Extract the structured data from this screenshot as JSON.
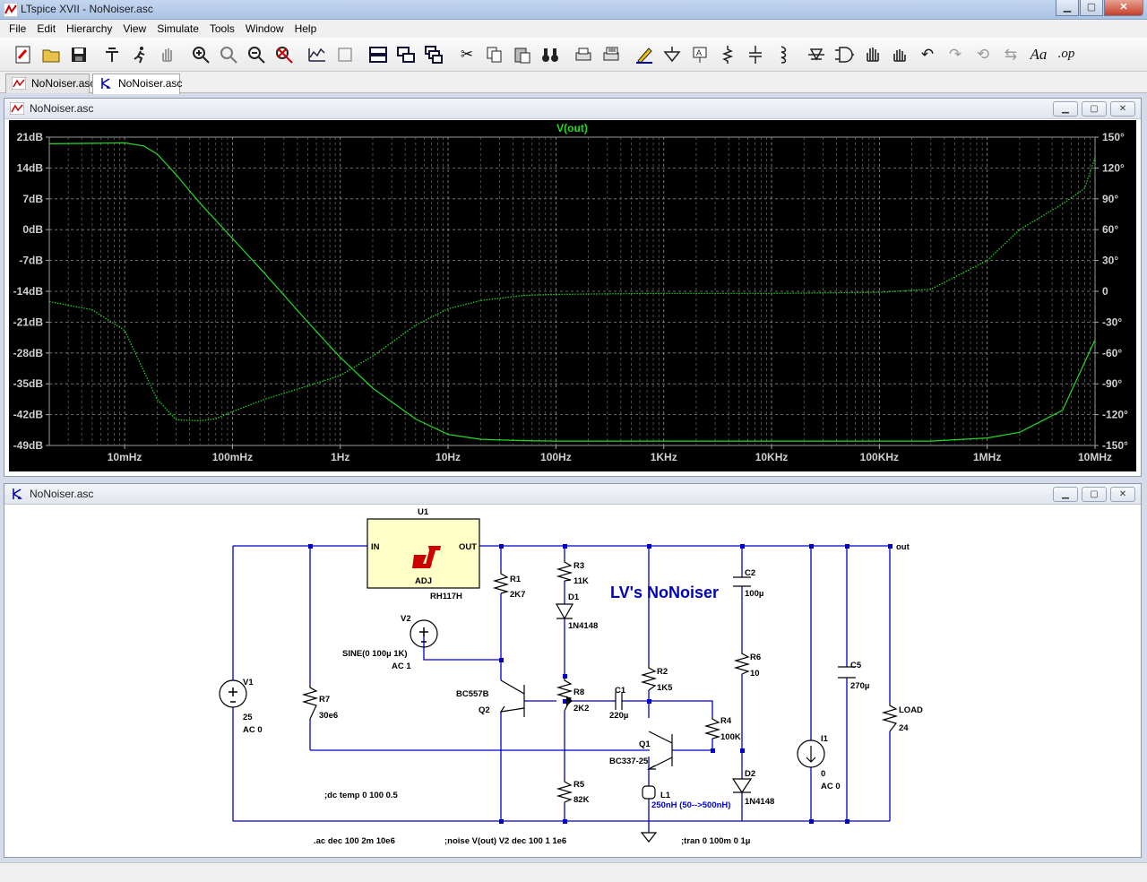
{
  "window": {
    "title": "LTspice XVII - NoNoiser.asc",
    "min_label": "▁",
    "max_label": "▢",
    "close_label": "✕"
  },
  "menu": [
    "File",
    "Edit",
    "Hierarchy",
    "View",
    "Simulate",
    "Tools",
    "Window",
    "Help"
  ],
  "toolbar_icons": [
    "new-schematic",
    "open",
    "save",
    "control-panel",
    "run",
    "halt",
    "zoom-in",
    "pan",
    "zoom-out",
    "zoom-fit",
    "autorange",
    "plot-settings",
    "tile-horizontal",
    "tile-vertical",
    "cascade",
    "cut",
    "copy",
    "paste",
    "find",
    "print",
    "print-setup",
    "wire",
    "ground",
    "label",
    "resistor",
    "capacitor",
    "inductor",
    "diode",
    "component",
    "move",
    "drag",
    "undo",
    "redo",
    "rotate",
    "mirror",
    "text",
    "spice-directive"
  ],
  "tabs": [
    {
      "label": "NoNoiser.asc",
      "kind": "waveform"
    },
    {
      "label": "NoNoiser.asc",
      "kind": "schematic"
    }
  ],
  "plot_window": {
    "title": "NoNoiser.asc",
    "trace_label": "V(out)",
    "trace_color": "#22dd22",
    "background": "#000000"
  },
  "schematic_window": {
    "title": "NoNoiser.asc",
    "heading": "LV's NoNoiser"
  },
  "chart_data": {
    "type": "line",
    "title": "V(out)",
    "x_scale": "log",
    "xlim": [
      0.002,
      10000000
    ],
    "x_ticks": [
      {
        "v": 0.01,
        "label": "10mHz"
      },
      {
        "v": 0.1,
        "label": "100mHz"
      },
      {
        "v": 1,
        "label": "1Hz"
      },
      {
        "v": 10,
        "label": "10Hz"
      },
      {
        "v": 100,
        "label": "100Hz"
      },
      {
        "v": 1000,
        "label": "1KHz"
      },
      {
        "v": 10000,
        "label": "10KHz"
      },
      {
        "v": 100000,
        "label": "100KHz"
      },
      {
        "v": 1000000,
        "label": "1MHz"
      },
      {
        "v": 10000000,
        "label": "10MHz"
      }
    ],
    "y_left": {
      "unit": "dB",
      "ylim": [
        -49,
        21
      ],
      "ticks": [
        "21dB",
        "14dB",
        "7dB",
        "0dB",
        "-7dB",
        "-14dB",
        "-21dB",
        "-28dB",
        "-35dB",
        "-42dB",
        "-49dB"
      ]
    },
    "y_right": {
      "unit": "degrees",
      "ylim": [
        -150,
        150
      ],
      "ticks": [
        "150°",
        "120°",
        "90°",
        "60°",
        "30°",
        "0",
        "-30°",
        "-60°",
        "-90°",
        "-120°",
        "-150°"
      ]
    },
    "grid": true,
    "series": [
      {
        "name": "V(out)",
        "axis": "left",
        "style": "solid",
        "x": [
          0.002,
          0.005,
          0.01,
          0.015,
          0.02,
          0.03,
          0.05,
          0.1,
          0.2,
          0.5,
          1,
          2,
          5,
          10,
          20,
          50,
          100,
          1000,
          10000,
          100000,
          300000,
          1000000,
          2000000,
          5000000,
          10000000
        ],
        "y": [
          19.5,
          19.6,
          19.7,
          19.0,
          17.2,
          12.5,
          6.0,
          -2.0,
          -10.0,
          -21.0,
          -29.0,
          -36.0,
          -43.0,
          -46.5,
          -47.6,
          -47.9,
          -48.0,
          -48.0,
          -48.0,
          -48.0,
          -48.0,
          -47.3,
          -46.0,
          -41.0,
          -25.0
        ]
      },
      {
        "name": "phase",
        "axis": "right",
        "style": "dotted",
        "x": [
          0.002,
          0.005,
          0.01,
          0.02,
          0.03,
          0.05,
          0.07,
          0.1,
          0.2,
          0.5,
          1,
          2,
          5,
          10,
          20,
          50,
          100,
          1000,
          10000,
          100000,
          300000,
          1000000,
          2000000,
          5000000,
          8000000,
          10000000
        ],
        "y": [
          -10.0,
          -18.0,
          -38.0,
          -105.0,
          -125.0,
          -126.0,
          -124.0,
          -117.0,
          -105.0,
          -92.0,
          -82.0,
          -63.0,
          -33.0,
          -17.0,
          -9.0,
          -4.0,
          -3.0,
          -2.0,
          -2.0,
          -1.0,
          2.0,
          30.0,
          60.0,
          85.0,
          100.0,
          130.0
        ]
      }
    ]
  },
  "schematic": {
    "labels": {
      "u1": "U1",
      "u1_in": "IN",
      "u1_out": "OUT",
      "u1_adj": "ADJ",
      "u1_part": "RH117H",
      "r1": "R1",
      "r1_val": "2K7",
      "r3": "R3",
      "r3_val": "11K",
      "d1": "D1",
      "d1_val": "1N4148",
      "c2": "C2",
      "c2_val": "100µ",
      "r6": "R6",
      "r6_val": "10",
      "c5": "C5",
      "c5_val": "270µ",
      "load": "LOAD",
      "load_val": "24",
      "out": "out",
      "v2": "V2",
      "v2_val": "SINE(0 100µ 1K)",
      "v2_ac": "AC 1",
      "v1": "V1",
      "v1_val": "25",
      "v1_ac": "AC 0",
      "r7": "R7",
      "r7_val": "30e6",
      "q2_part": "BC557B",
      "q2": "Q2",
      "r8": "R8",
      "r8_val": "2K2",
      "c1": "C1",
      "c1_val": "220µ",
      "r2": "R2",
      "r2_val": "1K5",
      "r4": "R4",
      "r4_val": "100K",
      "q1": "Q1",
      "q1_part": "BC337-25",
      "r5": "R5",
      "r5_val": "82K",
      "l1": "L1",
      "l1_val": "250nH (50-->500nH)",
      "d2": "D2",
      "d2_val": "1N4148",
      "i1": "I1",
      "i1_val": "0",
      "i1_ac": "AC 0",
      "dir_dc": ";dc temp 0 100 0.5",
      "dir_ac": ".ac dec 100 2m 10e6",
      "dir_noise": ";noise V(out) V2 dec 100 1 1e6",
      "dir_tran": ";tran 0 100m 0 1µ"
    }
  }
}
